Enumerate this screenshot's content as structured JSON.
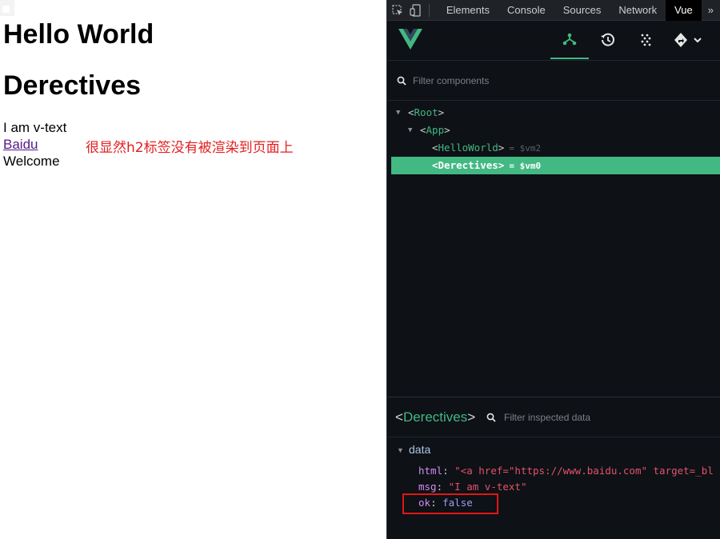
{
  "page": {
    "heading1": "Hello World",
    "heading2": "Derectives",
    "vtext_line": "I am v-text",
    "link_text": "Baidu",
    "welcome_line": "Welcome",
    "annotation": "很显然h2标签没有被渲染到页面上"
  },
  "devtools": {
    "tabs": [
      "Elements",
      "Console",
      "Sources",
      "Network",
      "Vue"
    ],
    "active_tab": "Vue",
    "more_label": "»",
    "filter_components_placeholder": "Filter components",
    "tree": {
      "root": "Root",
      "app": "App",
      "hello": "HelloWorld",
      "hello_vm": "= $vm2",
      "derectives": "Derectives",
      "derectives_vm": "= $vm0"
    },
    "inspected": {
      "name": "Derectives",
      "filter_placeholder": "Filter inspected data",
      "section": "data",
      "props": {
        "html_key": "html",
        "html_val": "\"<a href=\"https://www.baidu.com\" target=_bl",
        "msg_key": "msg",
        "msg_val": "\"I am v-text\"",
        "ok_key": "ok",
        "ok_val": "false"
      }
    },
    "colors": {
      "vue_green": "#42b883",
      "panel_bg": "#0e1116",
      "highlight_box": "#e31515"
    }
  }
}
